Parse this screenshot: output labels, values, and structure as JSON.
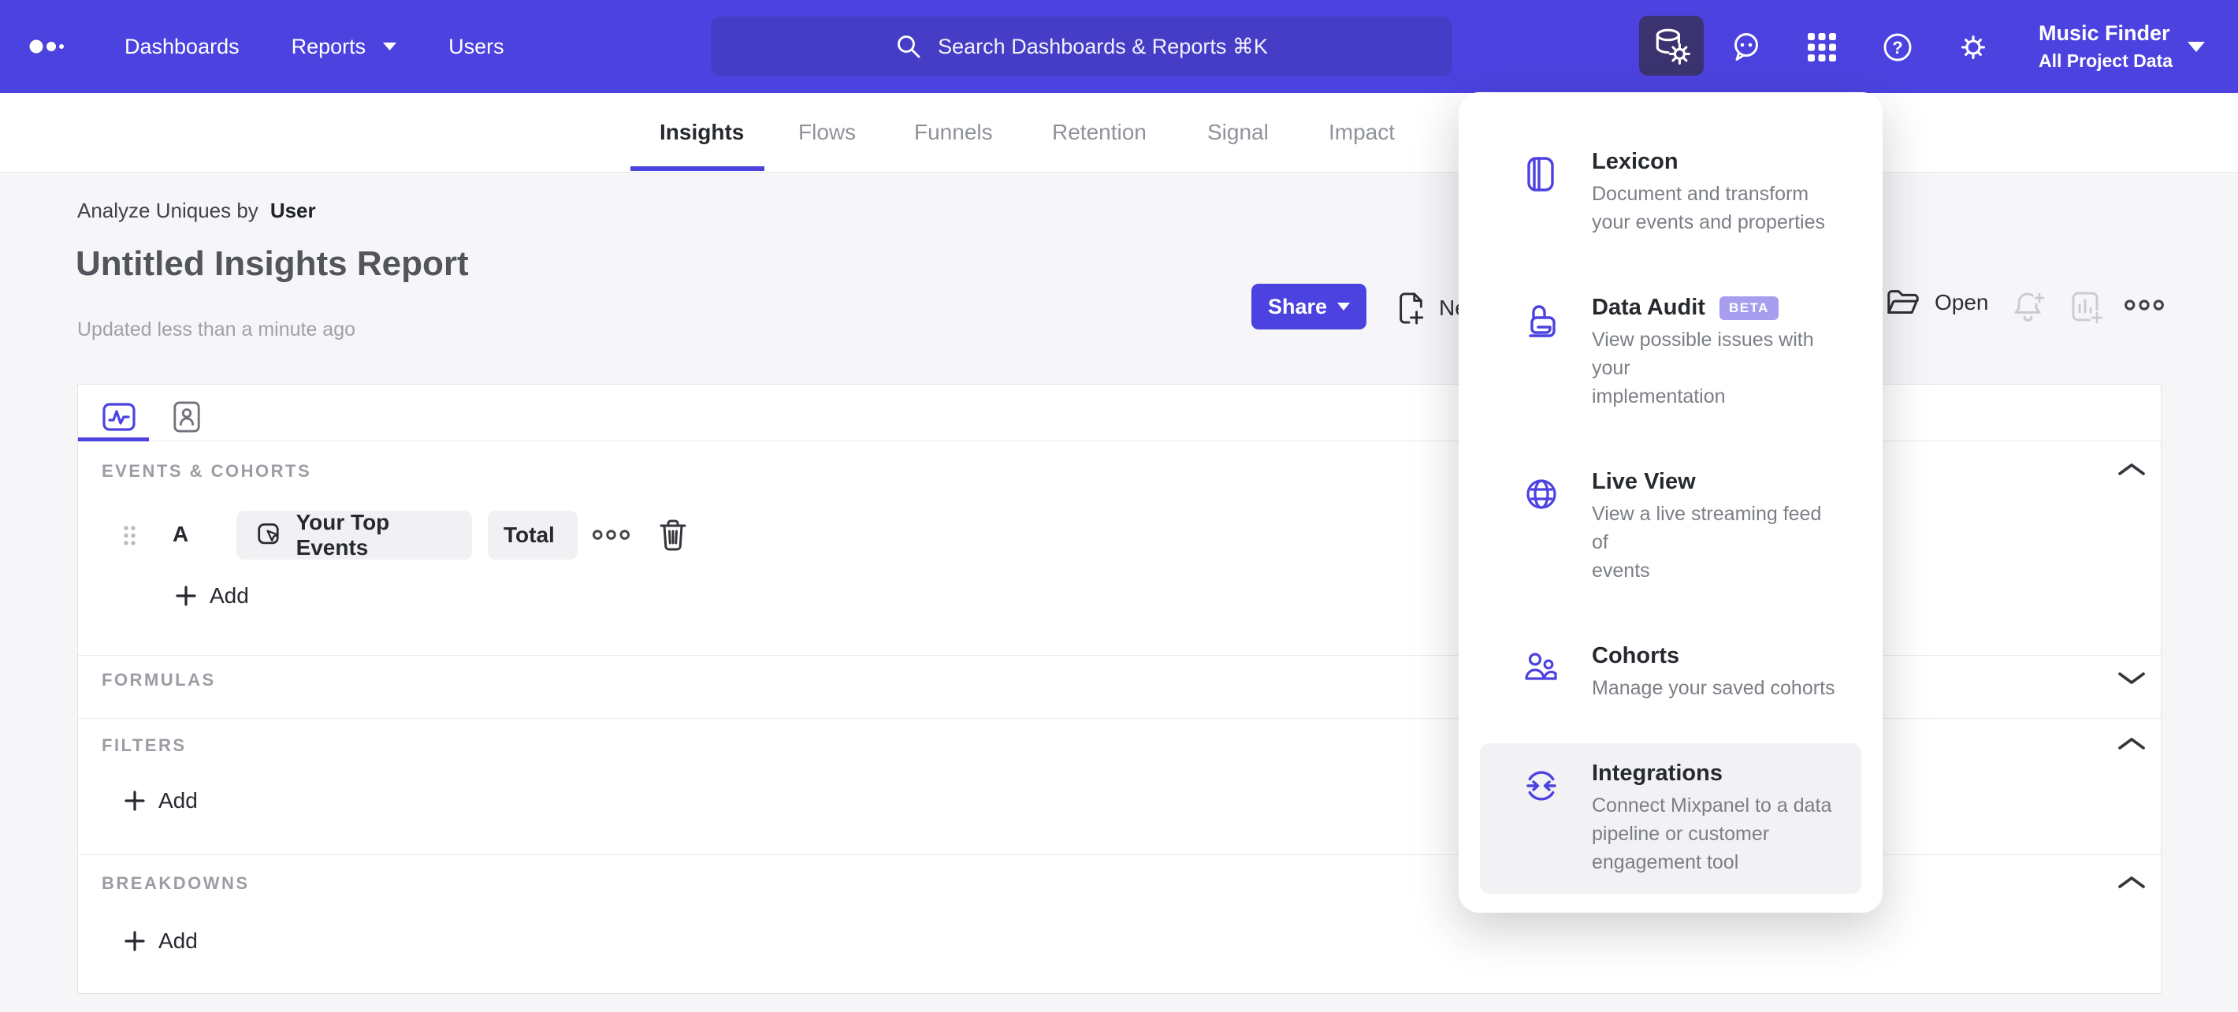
{
  "brand": {
    "purple": "#4c42e0",
    "nav_search_bg": "#463dc6",
    "active_icon_bg": "#3a336f",
    "beta_badge_bg": "#a89ef0"
  },
  "nav": {
    "links": [
      {
        "label": "Dashboards"
      },
      {
        "label": "Reports",
        "has_caret": true
      },
      {
        "label": "Users"
      }
    ],
    "search": {
      "placeholder": "Search Dashboards & Reports ⌘K"
    },
    "icons": [
      "data-management-icon (database+gear, active)",
      "feedback-icon (speech bubble)",
      "apps-grid-icon",
      "help-icon",
      "settings-gear-icon"
    ],
    "project": {
      "name": "Music Finder",
      "scope": "All Project Data"
    }
  },
  "report_tabs": {
    "items": [
      "Insights",
      "Flows",
      "Funnels",
      "Retention",
      "Signal",
      "Impact"
    ],
    "active": "Insights"
  },
  "report_header": {
    "analyze_prefix": "Analyze Uniques by",
    "analyze_entity": "User",
    "title": "Untitled Insights Report",
    "updated": "Updated less than a minute ago",
    "share_label": "Share",
    "new_label": "New",
    "open_label": "Open"
  },
  "query_builder": {
    "events": {
      "header": "EVENTS & COHORTS",
      "row": {
        "position": "A",
        "event_label": "Your Top Events",
        "aggregation_label": "Total"
      },
      "add_label": "Add"
    },
    "formulas": {
      "header": "FORMULAS"
    },
    "filters": {
      "header": "FILTERS",
      "add_label": "Add"
    },
    "breakdowns": {
      "header": "BREAKDOWNS",
      "add_label": "Add"
    }
  },
  "data_menu": {
    "items": [
      {
        "title": "Lexicon",
        "description": "Document and transform\nyour events and properties"
      },
      {
        "title": "Data Audit",
        "badge": "BETA",
        "description": "View possible issues with your\nimplementation"
      },
      {
        "title": "Live View",
        "description": "View a live streaming feed of\nevents"
      },
      {
        "title": "Cohorts",
        "description": "Manage your saved cohorts"
      },
      {
        "title": "Integrations",
        "description": "Connect Mixpanel to a data\npipeline or customer\nengagement tool",
        "state": "hover"
      }
    ]
  }
}
